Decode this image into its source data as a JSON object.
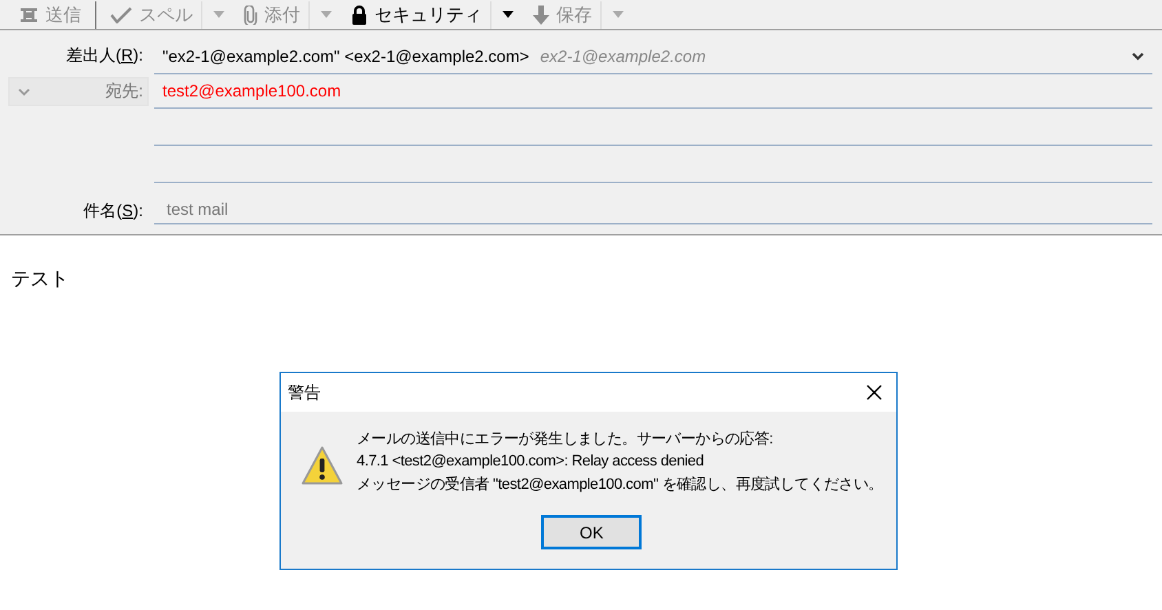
{
  "toolbar": [
    {
      "kind": "send",
      "label": "送信",
      "disabled": true,
      "has_menu": false,
      "separator_after": true
    },
    {
      "kind": "spell",
      "label": "スペル",
      "disabled": true,
      "has_menu": true,
      "separator_after": false
    },
    {
      "kind": "attach",
      "label": "添付",
      "disabled": true,
      "has_menu": true,
      "separator_after": false
    },
    {
      "kind": "security",
      "label": "セキュリティ",
      "disabled": false,
      "has_menu": true,
      "separator_after": false
    },
    {
      "kind": "save",
      "label": "保存",
      "disabled": true,
      "has_menu": true,
      "separator_after": false
    }
  ],
  "header": {
    "from": {
      "label_parts": [
        "差出人(",
        "R",
        "):"
      ],
      "value": "\"ex2-1@example2.com\" <ex2-1@example2.com>",
      "identity": "ex2-1@example2.com"
    },
    "recipients": [
      {
        "label": "宛先:",
        "value": "test2@example100.com",
        "invalid": true
      }
    ],
    "subject": {
      "label_parts": [
        "件名(",
        "S",
        "):"
      ],
      "placeholder": "test mail"
    }
  },
  "body": "テスト",
  "dialog": {
    "title": "警告",
    "lines": [
      "メールの送信中にエラーが発生しました。サーバーからの応答:",
      "4.7.1 <test2@example100.com>: Relay access denied",
      "メッセージの受信者 \"test2@example100.com\" を確認し、再度試してください。"
    ],
    "button": "OK"
  }
}
